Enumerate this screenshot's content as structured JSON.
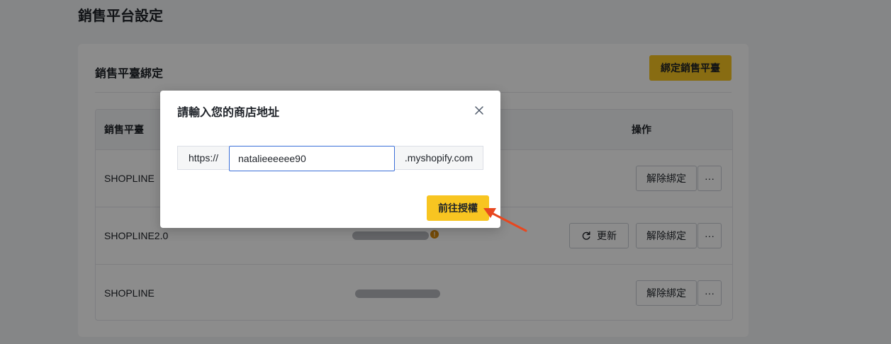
{
  "page": {
    "title": "銷售平台設定"
  },
  "card": {
    "title": "銷售平臺綁定",
    "bind_button": "綁定銷售平臺",
    "table": {
      "headers": {
        "platform": "銷售平臺",
        "action": "操作"
      },
      "rows": [
        {
          "platform": "SHOPLINE",
          "unbind": "解除綁定",
          "more": "···"
        },
        {
          "platform": "SHOPLINE2.0",
          "refresh": "更新",
          "unbind": "解除綁定",
          "more": "···",
          "info": "!"
        },
        {
          "platform": "SHOPLINE",
          "unbind": "解除綁定",
          "more": "···"
        }
      ]
    }
  },
  "modal": {
    "title": "請輸入您的商店地址",
    "prefix": "https://",
    "input_value": "natalieeeeee90",
    "suffix": ".myshopify.com",
    "submit": "前往授權"
  },
  "colors": {
    "primary": "#f8c521",
    "input_focus": "#3b6fd8",
    "arrow": "#e8471f",
    "info": "#d98b0e"
  }
}
